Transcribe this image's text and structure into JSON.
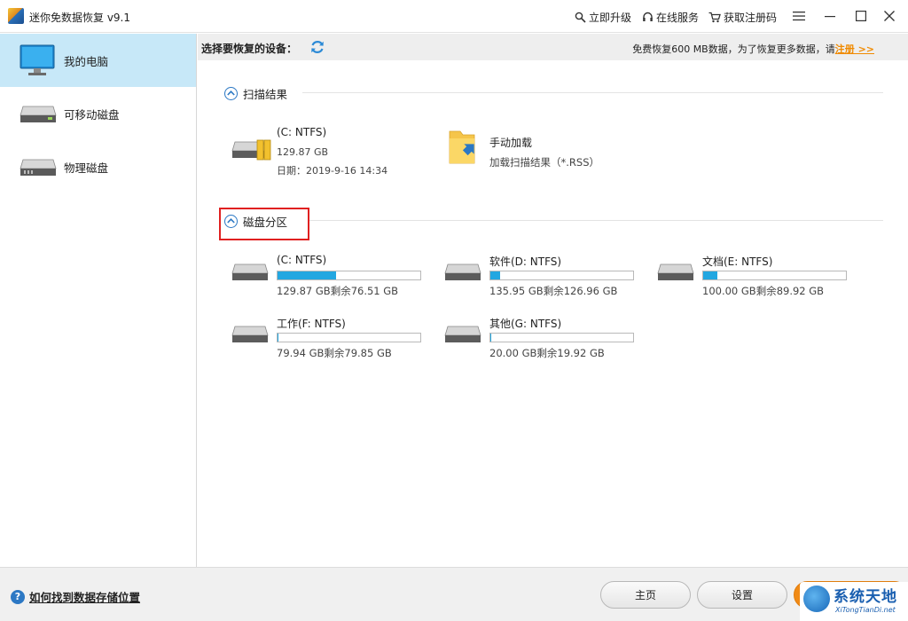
{
  "app": {
    "title": "迷你免数据恢复 v9.1"
  },
  "topbar": {
    "upgrade": "立即升级",
    "service": "在线服务",
    "register": "获取注册码"
  },
  "sidebar": {
    "items": [
      {
        "label": "我的电脑",
        "icon": "monitor-icon"
      },
      {
        "label": "可移动磁盘",
        "icon": "removable-disk-icon"
      },
      {
        "label": "物理磁盘",
        "icon": "physical-disk-icon"
      }
    ]
  },
  "main": {
    "select_label": "选择要恢复的设备：",
    "promo": "免费恢复600 MB数据，为了恢复更多数据，请",
    "register_link": "注册 >>"
  },
  "scan_results": {
    "heading": "扫描结果",
    "drive": {
      "name": "(C: NTFS)",
      "size": "129.87 GB",
      "date": "日期：2019-9-16 14:34"
    },
    "manual": {
      "name": "手动加载",
      "desc": "加载扫描结果（*.RSS）"
    }
  },
  "partitions": {
    "heading": "磁盘分区",
    "items": [
      {
        "name": "(C: NTFS)",
        "capacity": "129.87 GB剩余76.51 GB",
        "used_fraction": 0.41
      },
      {
        "name": "软件(D: NTFS)",
        "capacity": "135.95 GB剩余126.96 GB",
        "used_fraction": 0.066
      },
      {
        "name": "文档(E: NTFS)",
        "capacity": "100.00 GB剩余89.92 GB",
        "used_fraction": 0.1
      },
      {
        "name": "工作(F: NTFS)",
        "capacity": "79.94 GB剩余79.85 GB",
        "used_fraction": 0.001
      },
      {
        "name": "其他(G: NTFS)",
        "capacity": "20.00 GB剩余19.92 GB",
        "used_fraction": 0.004
      }
    ]
  },
  "footer": {
    "help": "如何找到数据存储位置",
    "home": "主页",
    "settings": "设置"
  },
  "watermark": {
    "title": "系统天地",
    "url": "XiTongTianDi.net"
  },
  "colors": {
    "accent": "#2c78c4",
    "bar_fill": "#23a7e1",
    "highlight_box": "#e02020",
    "register": "#f08a00",
    "active_side": "#c7e8f8"
  }
}
